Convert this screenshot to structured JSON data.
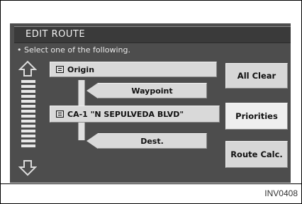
{
  "title": "EDIT ROUTE",
  "instruction": "• Select one of the following.",
  "route": {
    "origin": "Origin",
    "waypoint": "Waypoint",
    "street": "CA-1 \"N SEPULVEDA BLVD\"",
    "dest": "Dest."
  },
  "buttons": {
    "all_clear": "All Clear",
    "priorities": "Priorities",
    "route_calc": "Route Calc."
  },
  "caption": "INV0408"
}
